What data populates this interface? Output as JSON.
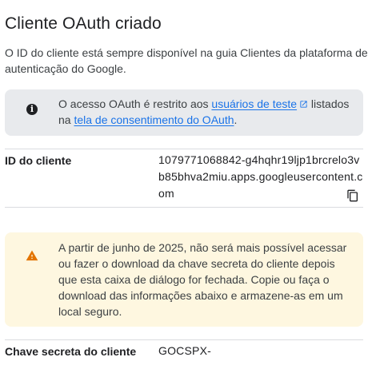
{
  "dialog": {
    "title": "Cliente OAuth criado",
    "intro": "O ID do cliente está sempre disponível na guia Clientes da plataforma de autenticação do Google."
  },
  "info_notice": {
    "icon": "info-icon",
    "text_before": "O acesso OAuth é restrito aos ",
    "link_test_users": "usuários de teste",
    "text_middle": " listados na ",
    "link_consent_screen": "tela de consentimento do OAuth",
    "text_after": "."
  },
  "client_id": {
    "label": "ID do cliente",
    "value": "1079771068842-g4hqhr19ljp1brcrelo3vb85bhva2miu.apps.googleusercontent.com",
    "copy_icon": "copy-icon"
  },
  "warning_notice": {
    "icon": "warning-icon",
    "text": "A partir de junho de 2025, não será mais possível acessar ou fazer o download da chave secreta do cliente depois que esta caixa de diálogo for fechada. Copie ou faça o download das informações abaixo e armazene-as em um local seguro."
  },
  "client_secret": {
    "label": "Chave secreta do cliente",
    "value": "GOCSPX-"
  },
  "colors": {
    "link": "#1a73e8",
    "info_bg": "#e8eaed",
    "warning_bg": "#fef7e0",
    "warning_icon": "#e37400"
  }
}
